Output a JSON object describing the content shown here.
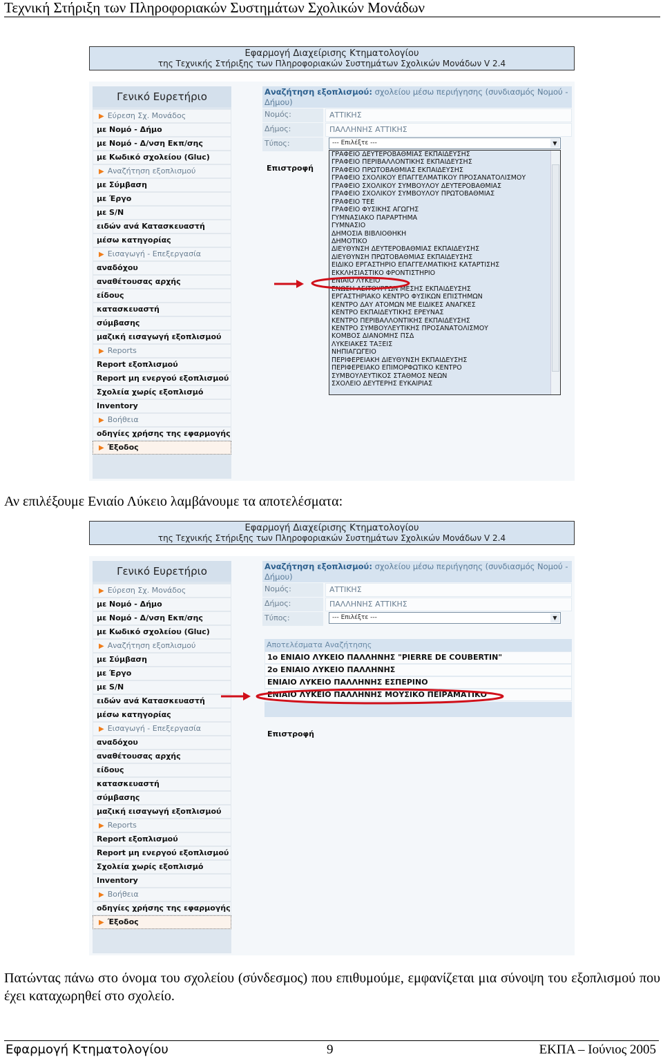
{
  "doc_header": "Τεχνική Στήριξη των Πληροφοριακών Συστημάτων Σχολικών Μονάδων",
  "app": {
    "title": "Εφαρμογή Διαχείρισης Κτηματολογίου",
    "subtitle": "της Τεχνικής Στήριξης των Πληροφοριακών Συστημάτων Σχολικών Μονάδων V 2.4",
    "sidebar": {
      "title": "Γενικό Ευρετήριο",
      "items": [
        {
          "label": "Εύρεση Σχ. Μονάδος",
          "type": "section"
        },
        {
          "label": "με Νομό - Δήμο",
          "type": "link"
        },
        {
          "label": "με Νομό - Δ/νση Εκπ/σης",
          "type": "link"
        },
        {
          "label": "με Κωδικό σχολείου (Gluc)",
          "type": "link"
        },
        {
          "label": "Αναζήτηση εξοπλισμού",
          "type": "section"
        },
        {
          "label": "με Σύμβαση",
          "type": "link"
        },
        {
          "label": "με Έργο",
          "type": "link"
        },
        {
          "label": "με S/N",
          "type": "link"
        },
        {
          "label": "ειδών ανά Κατασκευαστή",
          "type": "link"
        },
        {
          "label": "μέσω κατηγορίας",
          "type": "link"
        },
        {
          "label": "Εισαγωγή - Επεξεργασία",
          "type": "section"
        },
        {
          "label": "αναδόχου",
          "type": "link"
        },
        {
          "label": "αναθέτουσας αρχής",
          "type": "link"
        },
        {
          "label": "είδους",
          "type": "link"
        },
        {
          "label": "κατασκευαστή",
          "type": "link"
        },
        {
          "label": "σύμβασης",
          "type": "link"
        },
        {
          "label": "μαζική εισαγωγή εξοπλισμού",
          "type": "link"
        },
        {
          "label": "Reports",
          "type": "section"
        },
        {
          "label": "Report εξοπλισμού",
          "type": "link"
        },
        {
          "label": "Report μη ενεργού εξοπλισμού",
          "type": "link"
        },
        {
          "label": "Σχολεία χωρίς εξοπλισμό",
          "type": "link"
        },
        {
          "label": "Inventory",
          "type": "link"
        },
        {
          "label": "Βοήθεια",
          "type": "section"
        },
        {
          "label": "οδηγίες χρήσης της εφαρμογής",
          "type": "link"
        },
        {
          "label": "Έξοδος",
          "type": "exit"
        }
      ]
    },
    "search": {
      "title_bold": "Αναζήτηση εξοπλισμού:",
      "title_rest": " σχολείου μέσω περιήγησης (συνδιασμός Νομού - Δήμου)",
      "nomos_label": "Νομός:",
      "nomos_value": "ΑΤΤΙΚΗΣ",
      "dimos_label": "Δήμος:",
      "dimos_value": "ΠΑΛΛΗΝΗΣ ΑΤΤΙΚΗΣ",
      "typos_label": "Τύπος:",
      "typos_value": "--- Επιλέξτε ---",
      "back": "Επιστροφή"
    }
  },
  "shot1": {
    "dropdown_options": [
      "ΓΡΑΦΕΙΟ ΔΕΥΤΕΡΟΒΑΘΜΙΑΣ ΕΚΠΑΙΔΕΥΣΗΣ",
      "ΓΡΑΦΕΙΟ ΠΕΡΙΒΑΛΛΟΝΤΙΚΗΣ ΕΚΠΑΙΔΕΥΣΗΣ",
      "ΓΡΑΦΕΙΟ ΠΡΩΤΟΒΑΘΜΙΑΣ ΕΚΠΑΙΔΕΥΣΗΣ",
      "ΓΡΑΦΕΙΟ ΣΧΟΛΙΚΟΥ ΕΠΑΓΓΕΛΜΑΤΙΚΟΥ ΠΡΟΣΑΝΑΤΟΛΙΣΜΟΥ",
      "ΓΡΑΦΕΙΟ ΣΧΟΛΙΚΟΥ ΣΥΜΒΟΥΛΟΥ ΔΕΥΤΕΡΟΒΑΘΜΙΑΣ",
      "ΓΡΑΦΕΙΟ ΣΧΟΛΙΚΟΥ ΣΥΜΒΟΥΛΟΥ ΠΡΩΤΟΒΑΘΜΙΑΣ",
      "ΓΡΑΦΕΙΟ ΤΕΕ",
      "ΓΡΑΦΕΙΟ ΦΥΣΙΚΗΣ ΑΓΩΓΗΣ",
      "ΓΥΜΝΑΣΙΑΚΟ ΠΑΡΑΡΤΗΜΑ",
      "ΓΥΜΝΑΣΙΟ",
      "ΔΗΜΟΣΙΑ ΒΙΒΛΙΟΘΗΚΗ",
      "ΔΗΜΟΤΙΚΟ",
      "ΔΙΕΥΘΥΝΣΗ ΔΕΥΤΕΡΟΒΑΘΜΙΑΣ ΕΚΠΑΙΔΕΥΣΗΣ",
      "ΔΙΕΥΘΥΝΣΗ ΠΡΩΤΟΒΑΘΜΙΑΣ ΕΚΠΑΙΔΕΥΣΗΣ",
      "ΕΙΔΙΚΟ ΕΡΓΑΣΤΗΡΙΟ ΕΠΑΓΓΕΛΜΑΤΙΚΗΣ ΚΑΤΑΡΤΙΣΗΣ",
      "ΕΚΚΛΗΣΙΑΣΤΙΚΟ ΦΡΟΝΤΙΣΤΗΡΙΟ",
      "ΕΝΙΑΙΟ ΛΥΚΕΙΟ",
      "ΕΝΩΣΗ ΛΕΙΤΟΥΡΓΩΝ ΜΕΣΗΣ ΕΚΠΑΙΔΕΥΣΗΣ",
      "ΕΡΓΑΣΤΗΡΙΑΚΟ ΚΕΝΤΡΟ ΦΥΣΙΚΩΝ ΕΠΙΣΤΗΜΩΝ",
      "ΚΕΝΤΡΟ ΔΑΥ ΑΤΟΜΩΝ ΜΕ ΕΙΔΙΚΕΣ ΑΝΑΓΚΕΣ",
      "ΚΕΝΤΡΟ ΕΚΠΑΙΔΕΥΤΙΚΗΣ ΕΡΕΥΝΑΣ",
      "ΚΕΝΤΡΟ ΠΕΡΙΒΑΛΛΟΝΤΙΚΗΣ ΕΚΠΑΙΔΕΥΣΗΣ",
      "ΚΕΝΤΡΟ ΣΥΜΒΟΥΛΕΥΤΙΚΗΣ ΠΡΟΣΑΝΑΤΟΛΙΣΜΟΥ",
      "ΚΟΜΒΟΣ ΔΙΑΝΟΜΗΣ ΠΣΔ",
      "ΛΥΚΕΙΑΚΕΣ ΤΑΞΕΙΣ",
      "ΝΗΠΙΑΓΩΓΕΙΟ",
      "ΠΕΡΙΦΕΡΕΙΑΚΗ ΔΙΕΥΘΥΝΣΗ ΕΚΠΑΙΔΕΥΣΗΣ",
      "ΠΕΡΙΦΕΡΕΙΑΚΟ ΕΠΙΜΟΡΦΩΤΙΚΟ ΚΕΝΤΡΟ",
      "ΣΥΜΒΟΥΛΕΥΤΙΚΟΣ ΣΤΑΘΜΟΣ ΝΕΩΝ",
      "ΣΧΟΛΕΙΟ ΔΕΥΤΕΡΗΣ ΕΥΚΑΙΡΙΑΣ"
    ],
    "highlighted": "ΕΝΙΑΙΟ ΛΥΚΕΙΟ"
  },
  "para1": "Αν επιλέξουμε Ενιαίο Λύκειο λαμβάνουμε τα αποτελέσματα:",
  "shot2": {
    "results_title": "Αποτελέσματα Αναζήτησης",
    "results": [
      "1ο ΕΝΙΑΙΟ ΛΥΚΕΙΟ ΠΑΛΛΗΝΗΣ \"PIERRE DE COUBERTIN\"",
      "2ο ΕΝΙΑΙΟ ΛΥΚΕΙΟ ΠΑΛΛΗΝΗΣ",
      "ΕΝΙΑΙΟ ΛΥΚΕΙΟ ΠΑΛΛΗΝΗΣ ΕΣΠΕΡΙΝΟ",
      "ΕΝΙΑΙΟ ΛΥΚΕΙΟ ΠΑΛΛΗΝΗΣ ΜΟΥΣΙΚΟ ΠΕΙΡΑΜΑΤΙΚΟ"
    ],
    "highlighted": "ΕΝΙΑΙΟ ΛΥΚΕΙΟ ΠΑΛΛΗΝΗΣ ΜΟΥΣΙΚΟ ΠΕΙΡΑΜΑΤΙΚΟ"
  },
  "para2": "Πατώντας πάνω στο όνομα του σχολείου (σύνδεσμος) που επιθυμούμε, εμφανίζεται μια σύνοψη του εξοπλισμού που έχει καταχωρηθεί στο σχολείο.",
  "footer": {
    "left": "Εφαρμογή Κτηματολογίου",
    "page": "9",
    "right": "ΕΚΠΑ – Ιούνιος 2005"
  },
  "colors": {
    "highlight": "#d0101a",
    "banner": "#d6e3f0",
    "accent": "#f07d1a"
  }
}
